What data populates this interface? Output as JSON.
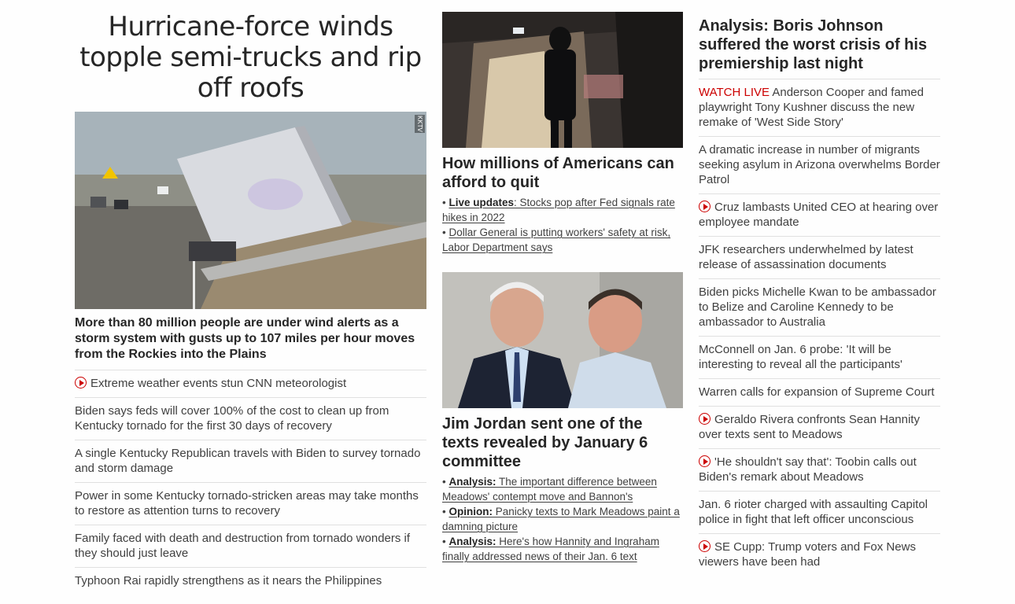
{
  "lead": {
    "title": "Hurricane-force winds topple semi-trucks and rip off roofs",
    "image_alt": "Semi-truck tipped over against a highway guardrail",
    "image_watermark": "KKTV",
    "subhead": "More than 80 million people are under wind alerts as a storm system with gusts up to 107 miles per hour moves from the Rockies into the Plains",
    "stories": [
      {
        "video": true,
        "text": "Extreme weather events stun CNN meteorologist"
      },
      {
        "video": false,
        "text": "Biden says feds will cover 100% of the cost to clean up from Kentucky tornado for the first 30 days of recovery"
      },
      {
        "video": false,
        "text": "A single Kentucky Republican travels with Biden to survey tornado and storm damage"
      },
      {
        "video": false,
        "text": "Power in some Kentucky tornado-stricken areas may take months to restore as attention turns to recovery"
      },
      {
        "video": false,
        "text": "Family faced with death and destruction from tornado wonders if they should just leave"
      },
      {
        "video": false,
        "text": "Typhoon Rai rapidly strengthens as it nears the Philippines"
      }
    ]
  },
  "middle": {
    "card1": {
      "image_alt": "Commuter standing on a train platform",
      "headline": "How millions of Americans can afford to quit",
      "bullets": [
        {
          "prefix": "Live updates",
          "text": ": Stocks pop after Fed signals rate hikes in 2022"
        },
        {
          "prefix": "",
          "text": "Dollar General is putting workers' safety at risk, Labor Department says"
        }
      ]
    },
    "card2": {
      "image_alt": "Mark Meadows and Jim Jordan",
      "headline": "Jim Jordan sent one of the texts revealed by January 6 committee",
      "bullets": [
        {
          "prefix": "Analysis:",
          "text": " The important difference between Meadows' contempt move and Bannon's"
        },
        {
          "prefix": "Opinion:",
          "text": " Panicky texts to Mark Meadows paint a damning picture"
        },
        {
          "prefix": "Analysis:",
          "text": " Here's how Hannity and Ingraham finally addressed news of their Jan. 6 text"
        }
      ]
    }
  },
  "right": {
    "headline": "Analysis: Boris Johnson suffered the worst crisis of his premiership last night",
    "stories": [
      {
        "video": false,
        "live": "WATCH LIVE",
        "text": " Anderson Cooper and famed playwright Tony Kushner discuss the new remake of 'West Side Story'"
      },
      {
        "video": false,
        "live": "",
        "text": "A dramatic increase in number of migrants seeking asylum in Arizona overwhelms Border Patrol"
      },
      {
        "video": true,
        "live": "",
        "text": "Cruz lambasts United CEO at hearing over employee mandate"
      },
      {
        "video": false,
        "live": "",
        "text": "JFK researchers underwhelmed by latest release of assassination documents"
      },
      {
        "video": false,
        "live": "",
        "text": "Biden picks Michelle Kwan to be ambassador to Belize and Caroline Kennedy to be ambassador to Australia"
      },
      {
        "video": false,
        "live": "",
        "text": "McConnell on Jan. 6 probe: 'It will be interesting to reveal all the participants'"
      },
      {
        "video": false,
        "live": "",
        "text": "Warren calls for expansion of Supreme Court"
      },
      {
        "video": true,
        "live": "",
        "text": "Geraldo Rivera confronts Sean Hannity over texts sent to Meadows"
      },
      {
        "video": true,
        "live": "",
        "text": "'He shouldn't say that': Toobin calls out Biden's remark about Meadows"
      },
      {
        "video": false,
        "live": "",
        "text": "Jan. 6 rioter charged with assaulting Capitol police in fight that left officer unconscious"
      },
      {
        "video": true,
        "live": "",
        "text": "SE Cupp: Trump voters and Fox News viewers have been had"
      }
    ]
  },
  "colors": {
    "accent": "#cc0000",
    "text": "#262626",
    "divider": "#e0e0e0"
  }
}
